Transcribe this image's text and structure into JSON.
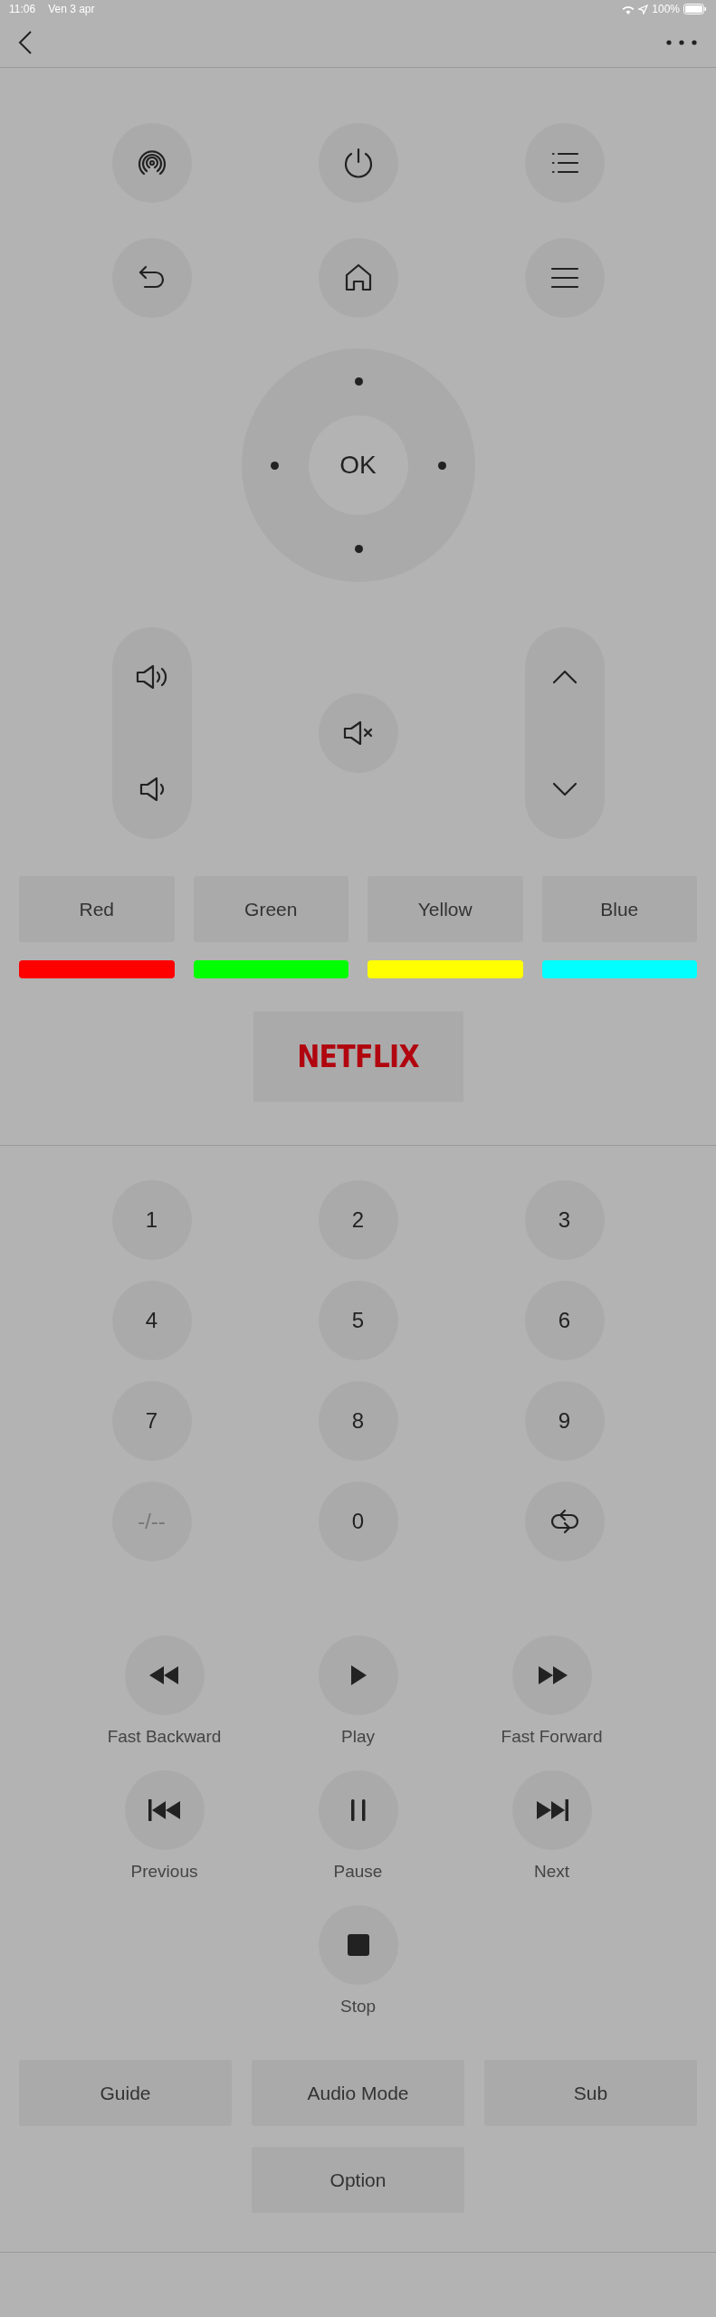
{
  "status_bar": {
    "time": "11:06",
    "date": "Ven 3 apr",
    "battery": "100%"
  },
  "dpad": {
    "center_label": "OK"
  },
  "color_keys": [
    {
      "label": "Red",
      "color": "#ff0000"
    },
    {
      "label": "Green",
      "color": "#00ff00"
    },
    {
      "label": "Yellow",
      "color": "#ffff00"
    },
    {
      "label": "Blue",
      "color": "#00ffff"
    }
  ],
  "netflix_button": {
    "label": "NETFLIX"
  },
  "number_keys": [
    {
      "label": "1",
      "disabled": false
    },
    {
      "label": "2",
      "disabled": false
    },
    {
      "label": "3",
      "disabled": false
    },
    {
      "label": "4",
      "disabled": false
    },
    {
      "label": "5",
      "disabled": false
    },
    {
      "label": "6",
      "disabled": false
    },
    {
      "label": "7",
      "disabled": false
    },
    {
      "label": "8",
      "disabled": false
    },
    {
      "label": "9",
      "disabled": false
    },
    {
      "label": "-/--",
      "disabled": true
    },
    {
      "label": "0",
      "disabled": false
    }
  ],
  "media_buttons": [
    {
      "label": "Fast Backward"
    },
    {
      "label": "Play"
    },
    {
      "label": "Fast Forward"
    },
    {
      "label": "Previous"
    },
    {
      "label": "Pause"
    },
    {
      "label": "Next"
    },
    {
      "label": "Stop"
    }
  ],
  "bottom_buttons": [
    {
      "label": "Guide"
    },
    {
      "label": "Audio Mode"
    },
    {
      "label": "Sub"
    },
    {
      "label": "Option"
    }
  ]
}
